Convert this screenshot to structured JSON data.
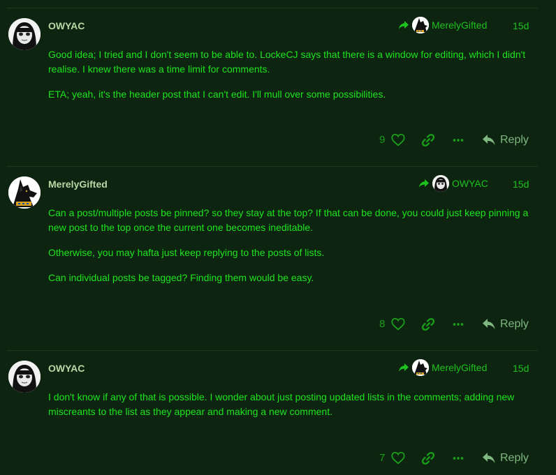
{
  "colors": {
    "background": "#0c2410",
    "body_text": "#1ee41e",
    "username": "#b6d9a6",
    "meta": "#1ec21e",
    "action_icon": "#1a9e1a",
    "reply_text": "#7fb87f"
  },
  "posts": [
    {
      "username": "OWYAC",
      "reply_to_user": "MerelyGifted",
      "date": "15d",
      "paragraphs": [
        "Good idea; I tried and I don't seem to be able to. LockeCJ says that there is a window for editing, which I didn't realise. I knew there was a time limit for comments.",
        "ETA; yeah, it's the header post that I can't edit. I'll mull over some possibilities."
      ],
      "likes": "9",
      "reply_label": "Reply"
    },
    {
      "username": "MerelyGifted",
      "reply_to_user": "OWYAC",
      "date": "15d",
      "paragraphs": [
        "Can a post/multiple posts be pinned? so they stay at the top? If that can be done, you could just keep pinning a new post to the top once the current one becomes ineditable.",
        "Otherwise, you may hafta just keep replying to the posts of lists.",
        "Can individual posts be tagged? Finding them would be easy."
      ],
      "likes": "8",
      "reply_label": "Reply"
    },
    {
      "username": "OWYAC",
      "reply_to_user": "MerelyGifted",
      "date": "15d",
      "paragraphs": [
        "I don't know if any of that is possible. I wonder about just posting updated lists in the comments; adding new miscreants to the list as they appear and making a new comment."
      ],
      "likes": "7",
      "reply_label": "Reply"
    }
  ],
  "icons": {
    "reply_arrow": "share-arrow-icon",
    "like": "heart-icon",
    "link": "link-icon",
    "more": "ellipsis-icon",
    "reply": "reply-icon"
  }
}
